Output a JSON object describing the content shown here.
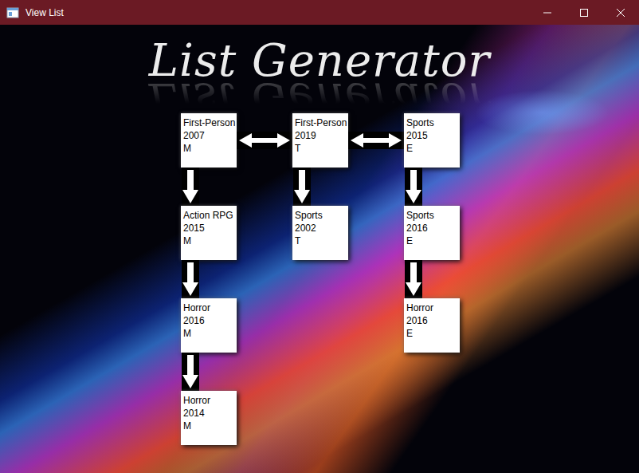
{
  "window": {
    "title": "View List"
  },
  "heading": "List Generator",
  "lists": [
    {
      "items": [
        {
          "genre": "First-Person",
          "year": "2007",
          "rating": "M"
        },
        {
          "genre": "Action RPG",
          "year": "2015",
          "rating": "M"
        },
        {
          "genre": "Horror",
          "year": "2016",
          "rating": "M"
        },
        {
          "genre": "Horror",
          "year": "2014",
          "rating": "M"
        }
      ]
    },
    {
      "items": [
        {
          "genre": "First-Person",
          "year": "2019",
          "rating": "T"
        },
        {
          "genre": "Sports",
          "year": "2002",
          "rating": "T"
        }
      ]
    },
    {
      "items": [
        {
          "genre": "Sports",
          "year": "2015",
          "rating": "E"
        },
        {
          "genre": "Sports",
          "year": "2016",
          "rating": "E"
        },
        {
          "genre": "Horror",
          "year": "2016",
          "rating": "E"
        }
      ]
    }
  ]
}
